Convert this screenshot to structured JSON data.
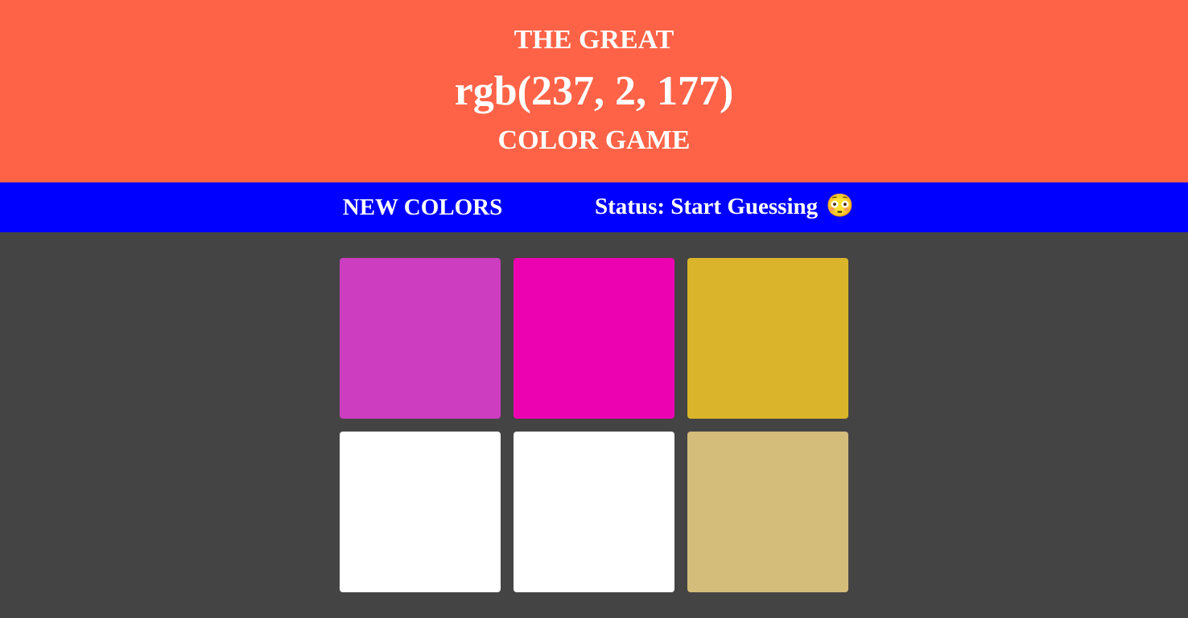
{
  "header": {
    "line1": "THE GREAT",
    "target_color": "rgb(237, 2, 177)",
    "line3": "COLOR GAME",
    "background": "#ff6347"
  },
  "stripe": {
    "background": "#0000ff",
    "new_colors_label": "NEW COLORS",
    "status_text": "Status: Start Guessing",
    "status_emoji": "😳"
  },
  "board": {
    "background": "#444444",
    "squares": [
      {
        "color": "#cc3dbf"
      },
      {
        "color": "#ed02b1"
      },
      {
        "color": "#dab52b"
      },
      {
        "color": "#ffffff"
      },
      {
        "color": "#ffffff"
      },
      {
        "color": "#d4bc7a"
      }
    ]
  }
}
